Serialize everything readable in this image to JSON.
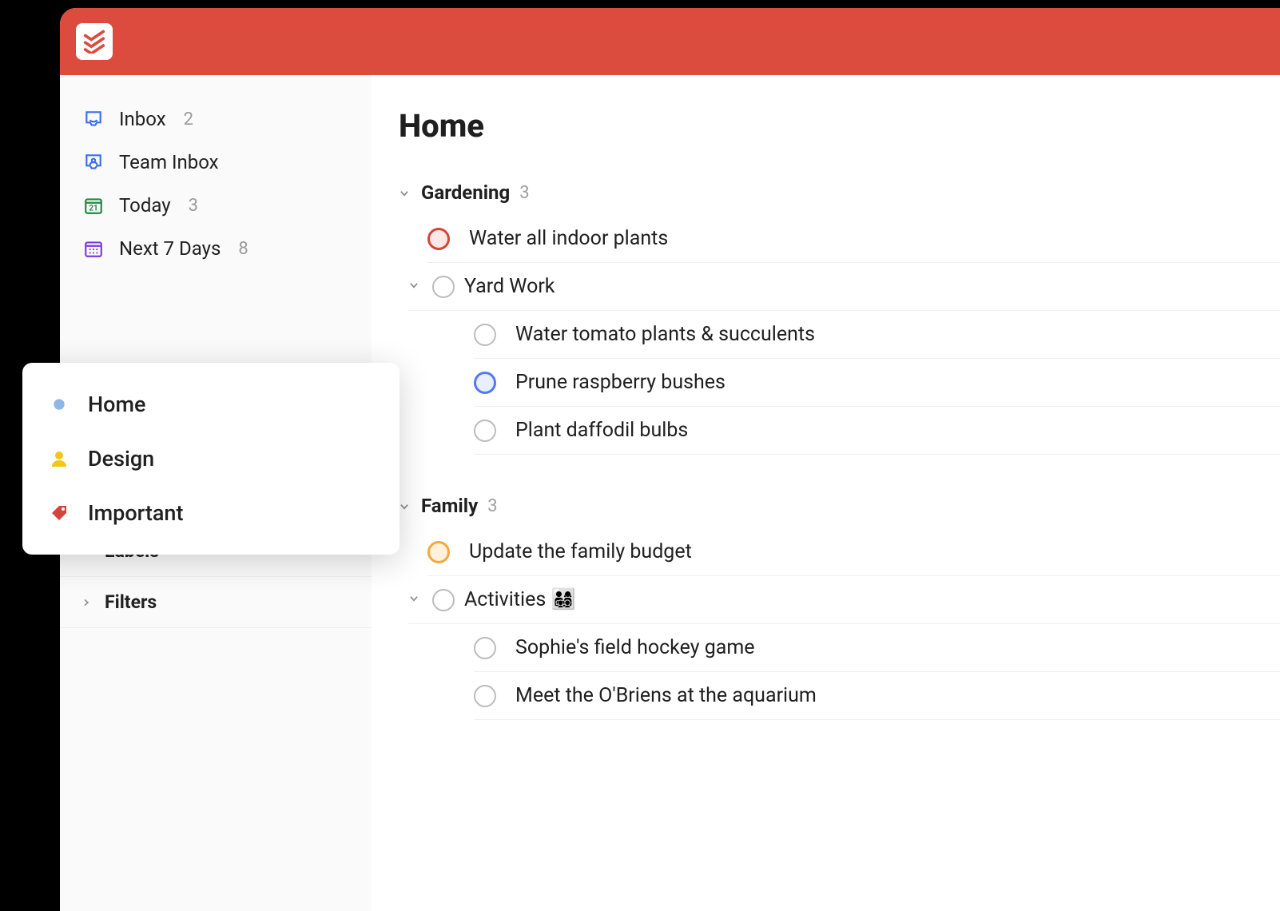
{
  "header": {
    "brand": "todoist"
  },
  "sidebar": {
    "items": [
      {
        "label": "Inbox",
        "count": "2",
        "icon": "inbox"
      },
      {
        "label": "Team Inbox",
        "count": "",
        "icon": "team-inbox"
      },
      {
        "label": "Today",
        "count": "3",
        "icon": "today"
      },
      {
        "label": "Next 7 Days",
        "count": "8",
        "icon": "next7"
      }
    ],
    "sections": [
      {
        "label": "Labels"
      },
      {
        "label": "Filters"
      }
    ]
  },
  "favorites": [
    {
      "label": "Home",
      "icon": "dot-blue"
    },
    {
      "label": "Design",
      "icon": "person-yellow"
    },
    {
      "label": "Important",
      "icon": "tag-red"
    }
  ],
  "main": {
    "title": "Home",
    "groups": [
      {
        "name": "Gardening",
        "count": "3",
        "tasks": [
          {
            "title": "Water all indoor plants",
            "priority": "red",
            "hasChildren": false
          },
          {
            "title": "Yard Work",
            "priority": "grey",
            "hasChildren": true,
            "children": [
              {
                "title": "Water tomato plants & succulents",
                "priority": "grey"
              },
              {
                "title": "Prune raspberry bushes",
                "priority": "blue"
              },
              {
                "title": "Plant daffodil bulbs",
                "priority": "grey"
              }
            ]
          }
        ]
      },
      {
        "name": "Family",
        "count": "3",
        "tasks": [
          {
            "title": "Update the family budget",
            "priority": "orange",
            "hasChildren": false
          },
          {
            "title": "Activities 👨‍👩‍👧‍👦",
            "priority": "grey",
            "hasChildren": true,
            "children": [
              {
                "title": "Sophie's field hockey game",
                "priority": "grey"
              },
              {
                "title": "Meet the O'Briens at the aquarium",
                "priority": "grey"
              }
            ]
          }
        ]
      }
    ]
  },
  "colors": {
    "accent": "#db4c3f"
  }
}
